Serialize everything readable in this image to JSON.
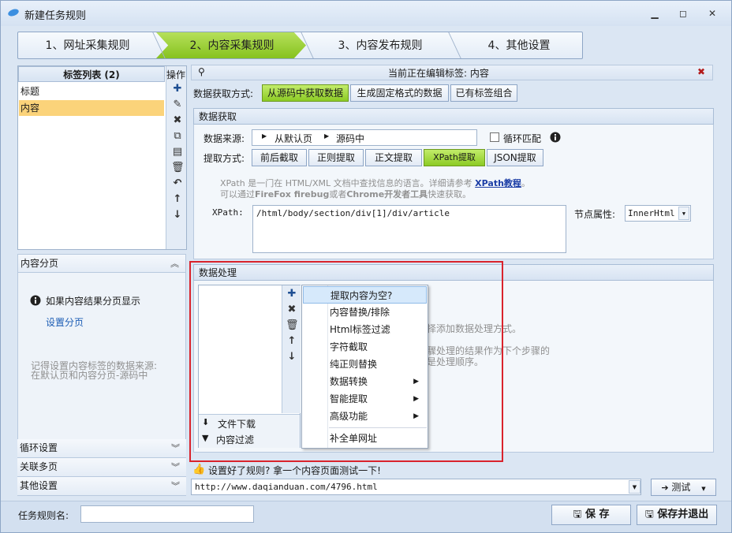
{
  "window": {
    "title": "新建任务规则"
  },
  "steps": [
    "1、网址采集规则",
    "2、内容采集规则",
    "3、内容发布规则",
    "4、其他设置"
  ],
  "left": {
    "tag_list_header": "标签列表 (2)",
    "ops_header": "操作",
    "tags": [
      "标题",
      "内容"
    ],
    "pagination_title": "内容分页",
    "pagination_info": "如果内容结果分页显示",
    "pagination_link": "设置分页",
    "pagination_note1": "记得设置内容标签的数据来源:",
    "pagination_note2": "在默认页和内容分页-源码中",
    "sections": [
      "循环设置",
      "关联多页",
      "其他设置"
    ]
  },
  "editing": {
    "label": "当前正在编辑标签: 内容"
  },
  "fetch_mode": {
    "label": "数据获取方式:",
    "options": [
      "从源码中获取数据",
      "生成固定格式的数据",
      "已有标签组合"
    ],
    "active": "从源码中获取数据"
  },
  "data_fetch": {
    "title": "数据获取",
    "source_label": "数据来源:",
    "source_parts": [
      "从默认页",
      "源码中"
    ],
    "loop_match": "循环匹配",
    "method_label": "提取方式:",
    "methods": [
      "前后截取",
      "正则提取",
      "正文提取",
      "XPath提取",
      "JSON提取"
    ],
    "active_method": "XPath提取",
    "hint_line1a": "XPath 是一门在 HTML/XML 文档中查找信息的语言。详细请参考",
    "hint_link": "XPath教程",
    "hint_end": "。",
    "hint_line2a": "可以通过",
    "hint_ff": "FireFox firebug",
    "hint_or": "或者",
    "hint_chrome": "Chrome开发者工具",
    "hint_fast": "快速获取。",
    "xpath_label": "XPath:",
    "xpath_value": "/html/body/section/div[1]/div/article",
    "node_attr_label": "节点属性:",
    "node_attr_value": "InnerHtml"
  },
  "data_process": {
    "title": "数据处理",
    "bg_text1": "择添加数据处理方式。",
    "bg_text2": "驟处理的结果作为下个步骤的",
    "bg_text3": "是处理顺序。",
    "bottom_items": [
      "文件下载",
      "内容过滤"
    ],
    "menu": [
      {
        "label": "提取内容为空?",
        "sub": false
      },
      {
        "label": "内容替换/排除",
        "sub": false
      },
      {
        "label": "Html标签过滤",
        "sub": false
      },
      {
        "label": "字符截取",
        "sub": false
      },
      {
        "label": "纯正则替换",
        "sub": false
      },
      {
        "label": "数据转换",
        "sub": true
      },
      {
        "label": "智能提取",
        "sub": true
      },
      {
        "label": "高级功能",
        "sub": true
      },
      {
        "label": "补全单网址",
        "sub": false
      }
    ]
  },
  "test": {
    "prompt": "设置好了规则? 拿一个内容页面测试一下!",
    "url": "http://www.daqianduan.com/4796.html",
    "button": "测试"
  },
  "footer": {
    "name_label": "任务规则名:",
    "name_value": "",
    "save": "保 存",
    "save_exit": "保存并退出"
  },
  "colors": {
    "accent_green": "#8ccb24",
    "highlight_red": "#d9232c",
    "selected_yellow": "#fbd37a"
  }
}
